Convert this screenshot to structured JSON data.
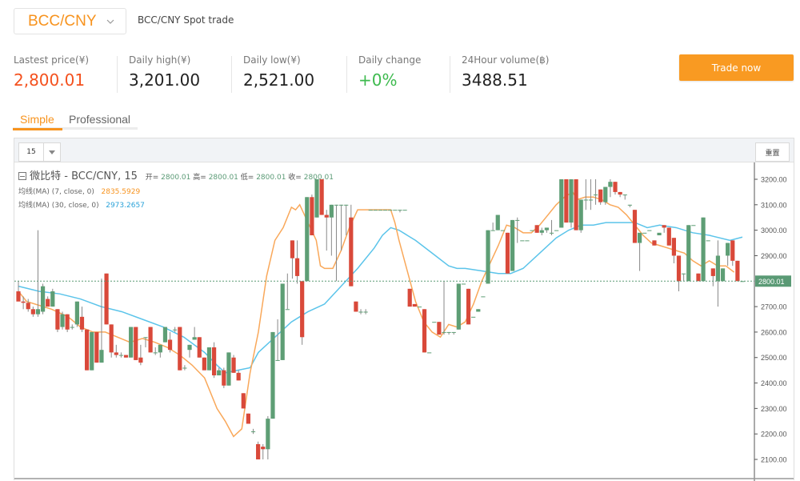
{
  "header": {
    "pair_selected": "BCC/CNY",
    "subtitle": "BCC/CNY Spot trade"
  },
  "stats": [
    {
      "label": "Lastest price(¥)",
      "value": "2,800.01",
      "color": "#f4511e"
    },
    {
      "label": "Daily high(¥)",
      "value": "3,201.00",
      "color": "#222222"
    },
    {
      "label": "Daily low(¥)",
      "value": "2,521.00",
      "color": "#222222"
    },
    {
      "label": "Daily change",
      "value": "+0%",
      "color": "#3dba4e"
    },
    {
      "label": "24Hour volume(฿)",
      "value": "3488.51",
      "color": "#222222"
    }
  ],
  "trade_button": "Trade now",
  "tabs": [
    {
      "label": "Simple",
      "active": true
    },
    {
      "label": "Professional",
      "active": false
    }
  ],
  "toolbar": {
    "interval": "15",
    "reset_label": "重置"
  },
  "legend": {
    "title": "微比特 - BCC/CNY, 15",
    "open_k": "开=",
    "open_v": "2800.01",
    "high_k": "高=",
    "high_v": "2800.01",
    "low_k": "低=",
    "low_v": "2800.01",
    "close_k": "收=",
    "close_v": "2800.01",
    "ma7_label": "均线(MA) (7, close, 0)",
    "ma7_value": "2835.5929",
    "ma30_label": "均线(MA) (30, close, 0)",
    "ma30_value": "2973.2657"
  },
  "colors": {
    "up": "#5e9e75",
    "down": "#d9493a",
    "ma7": "#f9a85a",
    "ma30": "#5bc4ea",
    "last_price_bg": "#5a9a75",
    "accent": "#f7931e"
  },
  "chart_data": {
    "type": "candlestick",
    "title": "微比特 - BCC/CNY, 15",
    "interval": "15",
    "ylim": [
      2060,
      3260
    ],
    "yticks": [
      3200,
      3100,
      3000,
      2900,
      2800,
      2700,
      2600,
      2500,
      2400,
      2300,
      2200,
      2100
    ],
    "ytick_labels": [
      "3200.00",
      "3100.00",
      "3000.00",
      "2900.00",
      "2800.00",
      "2700.00",
      "2600.00",
      "2500.00",
      "2400.00",
      "2300.00",
      "2200.00",
      "2100.00"
    ],
    "last_price": 2800.01,
    "last_price_label": "2800.01",
    "candles": [
      [
        2760,
        2800,
        2740,
        2720
      ],
      [
        2720,
        2740,
        2690,
        2715
      ],
      [
        2715,
        2730,
        2680,
        2690
      ],
      [
        2690,
        2700,
        2660,
        2670
      ],
      [
        2670,
        3000,
        2660,
        2690
      ],
      [
        2680,
        2790,
        2670,
        2780
      ],
      [
        2730,
        2740,
        2700,
        2700
      ],
      [
        2700,
        2770,
        2700,
        2760
      ],
      [
        2690,
        2690,
        2600,
        2610
      ],
      [
        2620,
        2680,
        2610,
        2670
      ],
      [
        2670,
        2670,
        2600,
        2610
      ],
      [
        2620,
        2630,
        2610,
        2620
      ],
      [
        2630,
        2720,
        2620,
        2720
      ],
      [
        2660,
        2700,
        2600,
        2610
      ],
      [
        2610,
        2610,
        2450,
        2450
      ],
      [
        2450,
        2600,
        2450,
        2600
      ],
      [
        2600,
        2600,
        2480,
        2480
      ],
      [
        2480,
        2810,
        2480,
        2530
      ],
      [
        2830,
        2830,
        2630,
        2630
      ],
      [
        2630,
        2630,
        2500,
        2520
      ],
      [
        2520,
        2550,
        2500,
        2510
      ],
      [
        2510,
        2520,
        2500,
        2510
      ],
      [
        2510,
        2510,
        2500,
        2500
      ],
      [
        2500,
        2620,
        2500,
        2620
      ],
      [
        2620,
        2620,
        2490,
        2490
      ],
      [
        2500,
        2550,
        2470,
        2480
      ],
      [
        2580,
        2580,
        2540,
        2580
      ],
      [
        2620,
        2620,
        2520,
        2520
      ],
      [
        2520,
        2540,
        2510,
        2520
      ],
      [
        2520,
        2550,
        2500,
        2550
      ],
      [
        2560,
        2620,
        2560,
        2620
      ],
      [
        2570,
        2600,
        2520,
        2530
      ],
      [
        2610,
        2620,
        2600,
        2610
      ],
      [
        2620,
        2620,
        2450,
        2450
      ],
      [
        2460,
        2470,
        2450,
        2460
      ],
      [
        2530,
        2550,
        2500,
        2550
      ],
      [
        2570,
        2620,
        2570,
        2580
      ],
      [
        2580,
        2580,
        2500,
        2500
      ],
      [
        2500,
        2500,
        2450,
        2450
      ],
      [
        2450,
        2540,
        2450,
        2540
      ],
      [
        2540,
        2560,
        2420,
        2430
      ],
      [
        2430,
        2460,
        2440,
        2450
      ],
      [
        2450,
        2460,
        2380,
        2390
      ],
      [
        2390,
        2520,
        2390,
        2520
      ],
      [
        2500,
        2510,
        2440,
        2440
      ],
      [
        2440,
        2450,
        2410,
        2410
      ],
      [
        2360,
        2360,
        2300,
        2300
      ],
      [
        2280,
        2280,
        2240,
        2240
      ],
      [
        2210,
        2220,
        2200,
        2210
      ],
      [
        2160,
        2170,
        2100,
        2100
      ],
      [
        2150,
        2160,
        2100,
        2140
      ],
      [
        2140,
        2270,
        2100,
        2260
      ],
      [
        2260,
        2600,
        2260,
        2600
      ],
      [
        2490,
        2650,
        2490,
        2490
      ],
      [
        2490,
        2790,
        2490,
        2790
      ],
      [
        2690,
        2830,
        2690,
        2690
      ],
      [
        2960,
        2960,
        2810,
        2890
      ],
      [
        2890,
        2960,
        2790,
        2820
      ],
      [
        2800,
        2800,
        2550,
        2580
      ],
      [
        2800,
        3130,
        2800,
        3130
      ],
      [
        3130,
        3140,
        2980,
        2980
      ],
      [
        3050,
        3200,
        3050,
        3200
      ],
      [
        3200,
        3200,
        3060,
        3060
      ],
      [
        3060,
        3080,
        2920,
        3050
      ],
      [
        3050,
        3100,
        2900,
        3100
      ],
      [
        3100,
        3100,
        2800,
        3100
      ],
      [
        3100,
        3100,
        2920,
        3100
      ],
      [
        3100,
        3100,
        2980,
        3100
      ],
      [
        3050,
        3100,
        2780,
        2780
      ],
      [
        2720,
        2720,
        2680,
        2680
      ],
      [
        2680,
        2690,
        2670,
        2680
      ],
      [
        2680,
        2690,
        2670,
        2680
      ],
      [
        3080,
        3080,
        3080,
        3080
      ],
      [
        3080,
        3080,
        3080,
        3080
      ],
      [
        3080,
        3080,
        3080,
        3080
      ],
      [
        3080,
        3080,
        3080,
        3080
      ],
      [
        3080,
        3080,
        3080,
        3080
      ],
      [
        3080,
        3080,
        3080,
        3080
      ],
      [
        3080,
        3080,
        3070,
        3080
      ],
      [
        3080,
        3080,
        3080,
        3080
      ],
      [
        2770,
        2770,
        2700,
        2700
      ],
      [
        2710,
        2710,
        2700,
        2700
      ],
      [
        2700,
        2700,
        2700,
        2700
      ],
      [
        2690,
        2690,
        2520,
        2520
      ],
      [
        2520,
        2520,
        2520,
        2520
      ],
      [
        2640,
        2640,
        2640,
        2640
      ],
      [
        2640,
        2640,
        2590,
        2590
      ],
      [
        2600,
        2800,
        2590,
        2600
      ],
      [
        2600,
        2600,
        2590,
        2600
      ],
      [
        2600,
        2600,
        2590,
        2600
      ],
      [
        2610,
        2790,
        2610,
        2790
      ],
      [
        2790,
        2790,
        2790,
        2790
      ],
      [
        2770,
        2770,
        2630,
        2630
      ],
      [
        2660,
        2660,
        2660,
        2660
      ],
      [
        2680,
        2690,
        2680,
        2690
      ],
      [
        2740,
        2740,
        2740,
        2740
      ],
      [
        2790,
        3000,
        2790,
        3000
      ],
      [
        3000,
        3030,
        3000,
        3000
      ],
      [
        3000,
        3060,
        3000,
        3060
      ],
      [
        3000,
        3000,
        3000,
        3000
      ],
      [
        2990,
        2990,
        2830,
        2830
      ],
      [
        2840,
        3040,
        2840,
        3040
      ],
      [
        3040,
        3050,
        2950,
        3040
      ],
      [
        2960,
        2960,
        2960,
        2960
      ],
      [
        2960,
        2960,
        2960,
        2960
      ],
      [
        3000,
        3000,
        3000,
        3000
      ],
      [
        3020,
        3020,
        2990,
        2990
      ],
      [
        2990,
        3010,
        2980,
        3000
      ],
      [
        3000,
        3010,
        2990,
        3010
      ],
      [
        2990,
        3040,
        2980,
        2990
      ],
      [
        3000,
        3000,
        3000,
        3000
      ],
      [
        3010,
        3200,
        3010,
        3200
      ],
      [
        3200,
        3200,
        3030,
        3030
      ],
      [
        3030,
        3200,
        3010,
        3200
      ],
      [
        3200,
        3200,
        3000,
        3000
      ],
      [
        3000,
        3120,
        2990,
        3120
      ],
      [
        3120,
        3200,
        3080,
        3120
      ],
      [
        3120,
        3200,
        3080,
        3120
      ],
      [
        3140,
        3200,
        3100,
        3140
      ],
      [
        3160,
        3160,
        3100,
        3110
      ],
      [
        3110,
        3150,
        3100,
        3170
      ],
      [
        3170,
        3200,
        3130,
        3190
      ],
      [
        3190,
        3190,
        3140,
        3150
      ],
      [
        3150,
        3150,
        3130,
        3140
      ],
      [
        3140,
        3140,
        3120,
        3140
      ],
      [
        3100,
        3100,
        3090,
        3100
      ],
      [
        3080,
        3080,
        2950,
        2950
      ],
      [
        2950,
        2950,
        2840,
        2990
      ],
      [
        2990,
        2990,
        2990,
        2990
      ],
      [
        3000,
        3000,
        3000,
        3000
      ],
      [
        2960,
        2960,
        2940,
        2940
      ],
      [
        2980,
        2990,
        2990,
        2990
      ],
      [
        3020,
        3020,
        2990,
        3010
      ],
      [
        3010,
        3010,
        2940,
        2940
      ],
      [
        2970,
        2970,
        2870,
        2900
      ],
      [
        2900,
        2900,
        2760,
        2800
      ],
      [
        2830,
        2830,
        2800,
        2830
      ],
      [
        2800,
        3020,
        2800,
        3020
      ],
      [
        3020,
        3020,
        3020,
        3020
      ],
      [
        2830,
        2830,
        2800,
        2800
      ],
      [
        2800,
        3050,
        2800,
        3050
      ],
      [
        2960,
        2960,
        2960,
        2960
      ],
      [
        2850,
        2850,
        2780,
        2820
      ],
      [
        2800,
        2960,
        2700,
        2900
      ],
      [
        2800,
        2850,
        2800,
        2850
      ],
      [
        2900,
        2950,
        2860,
        2950
      ],
      [
        2960,
        2960,
        2860,
        2880
      ],
      [
        2880,
        2880,
        2800,
        2800
      ],
      [
        2800,
        2800,
        2800,
        2800
      ]
    ],
    "ma7": [
      [
        0,
        2760
      ],
      [
        2,
        2720
      ],
      [
        5,
        2705
      ],
      [
        8,
        2690
      ],
      [
        12,
        2660
      ],
      [
        15,
        2620
      ],
      [
        18,
        2600
      ],
      [
        21,
        2600
      ],
      [
        24,
        2580
      ],
      [
        27,
        2560
      ],
      [
        30,
        2575
      ],
      [
        33,
        2560
      ],
      [
        36,
        2540
      ],
      [
        39,
        2510
      ],
      [
        42,
        2470
      ],
      [
        45,
        2420
      ],
      [
        48,
        2300
      ],
      [
        50,
        2250
      ],
      [
        52,
        2190
      ],
      [
        54,
        2220
      ],
      [
        56,
        2440
      ],
      [
        58,
        2600
      ],
      [
        60,
        2820
      ],
      [
        62,
        2960
      ],
      [
        64,
        3010
      ],
      [
        66,
        3090
      ],
      [
        67,
        3080
      ],
      [
        68,
        3100
      ],
      [
        70,
        3030
      ],
      [
        72,
        2960
      ],
      [
        73,
        2860
      ],
      [
        74,
        2850
      ],
      [
        76,
        2850
      ],
      [
        78,
        2920
      ],
      [
        80,
        3010
      ],
      [
        82,
        3080
      ],
      [
        85,
        3080
      ],
      [
        88,
        3080
      ],
      [
        90,
        3080
      ],
      [
        91,
        3030
      ],
      [
        92,
        2960
      ],
      [
        94,
        2840
      ],
      [
        96,
        2720
      ],
      [
        98,
        2640
      ],
      [
        100,
        2600
      ],
      [
        102,
        2580
      ],
      [
        104,
        2630
      ],
      [
        106,
        2620
      ],
      [
        108,
        2640
      ],
      [
        110,
        2710
      ],
      [
        112,
        2800
      ],
      [
        114,
        2870
      ],
      [
        116,
        2940
      ],
      [
        118,
        3020
      ],
      [
        120,
        3010
      ],
      [
        122,
        2990
      ],
      [
        124,
        2990
      ],
      [
        126,
        3020
      ],
      [
        128,
        3060
      ],
      [
        130,
        3100
      ],
      [
        132,
        3130
      ],
      [
        134,
        3150
      ],
      [
        135,
        3120
      ],
      [
        137,
        3130
      ],
      [
        139,
        3130
      ],
      [
        141,
        3120
      ],
      [
        143,
        3100
      ],
      [
        145,
        3090
      ],
      [
        147,
        3060
      ],
      [
        149,
        3020
      ],
      [
        151,
        2980
      ],
      [
        153,
        2950
      ],
      [
        155,
        2940
      ],
      [
        157,
        2930
      ],
      [
        159,
        2920
      ],
      [
        161,
        2910
      ],
      [
        163,
        2880
      ],
      [
        165,
        2860
      ],
      [
        167,
        2880
      ],
      [
        169,
        2860
      ],
      [
        171,
        2860
      ],
      [
        173,
        2835
      ]
    ],
    "ma30": [
      [
        0,
        2780
      ],
      [
        5,
        2760
      ],
      [
        10,
        2750
      ],
      [
        15,
        2730
      ],
      [
        20,
        2700
      ],
      [
        25,
        2680
      ],
      [
        30,
        2650
      ],
      [
        35,
        2620
      ],
      [
        40,
        2580
      ],
      [
        45,
        2520
      ],
      [
        48,
        2470
      ],
      [
        50,
        2440
      ],
      [
        53,
        2450
      ],
      [
        56,
        2460
      ],
      [
        58,
        2520
      ],
      [
        62,
        2580
      ],
      [
        66,
        2640
      ],
      [
        70,
        2680
      ],
      [
        74,
        2710
      ],
      [
        78,
        2780
      ],
      [
        82,
        2850
      ],
      [
        86,
        2930
      ],
      [
        88,
        2980
      ],
      [
        90,
        3010
      ],
      [
        92,
        3000
      ],
      [
        96,
        2960
      ],
      [
        100,
        2910
      ],
      [
        104,
        2860
      ],
      [
        106,
        2850
      ],
      [
        108,
        2850
      ],
      [
        112,
        2840
      ],
      [
        116,
        2830
      ],
      [
        119,
        2830
      ],
      [
        122,
        2850
      ],
      [
        126,
        2910
      ],
      [
        130,
        2970
      ],
      [
        133,
        3000
      ],
      [
        136,
        3020
      ],
      [
        139,
        3020
      ],
      [
        142,
        3030
      ],
      [
        145,
        3030
      ],
      [
        149,
        3030
      ],
      [
        152,
        3010
      ],
      [
        155,
        3020
      ],
      [
        159,
        3010
      ],
      [
        163,
        2990
      ],
      [
        167,
        2980
      ],
      [
        172,
        2960
      ],
      [
        175,
        2973
      ]
    ]
  }
}
